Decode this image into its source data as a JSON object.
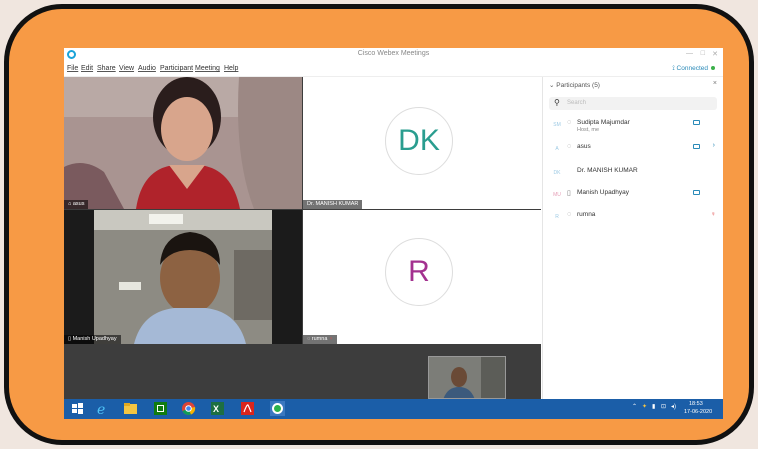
{
  "window": {
    "title": "Cisco Webex Meetings",
    "controls": {
      "minimize": "—",
      "maximize": "□",
      "close": "✕"
    }
  },
  "menu": [
    "File",
    "Edit",
    "Share",
    "View",
    "Audio",
    "Participant",
    "Meeting",
    "Help"
  ],
  "status": {
    "connected_label": "Connected"
  },
  "video_tiles": [
    {
      "label": "asus",
      "type": "video"
    },
    {
      "label": "Dr. MANISH KUMAR",
      "type": "avatar",
      "initials": "DK",
      "initials_color": "#2a9d8f"
    },
    {
      "label": "Manish Upadhyay",
      "type": "video"
    },
    {
      "label": "rumna",
      "type": "avatar",
      "initials": "R",
      "initials_color": "#a3318f",
      "muted": true
    }
  ],
  "participants_panel": {
    "header": "Participants (5)",
    "search_placeholder": "Search",
    "close": "×",
    "list": [
      {
        "initials": "SM",
        "name": "Sudipta Majumdar",
        "subtitle": "Host, me",
        "camera": true
      },
      {
        "initials": "A",
        "name": "asus",
        "camera": true,
        "expand": true
      },
      {
        "initials": "DK",
        "name": "Dr. MANISH KUMAR"
      },
      {
        "initials": "MU",
        "name": "Manish Upadhyay",
        "camera": true
      },
      {
        "initials": "R",
        "name": "rumna",
        "muted": true
      }
    ]
  },
  "taskbar": {
    "time": "18:53",
    "date": "17-06-2020",
    "apps": [
      "start",
      "internet-explorer",
      "file-explorer",
      "store",
      "chrome",
      "excel",
      "acrobat",
      "webex"
    ]
  },
  "colors": {
    "frame": "#f79a45",
    "taskbar": "#1b5ea8",
    "accent": "#2a8ab8"
  }
}
